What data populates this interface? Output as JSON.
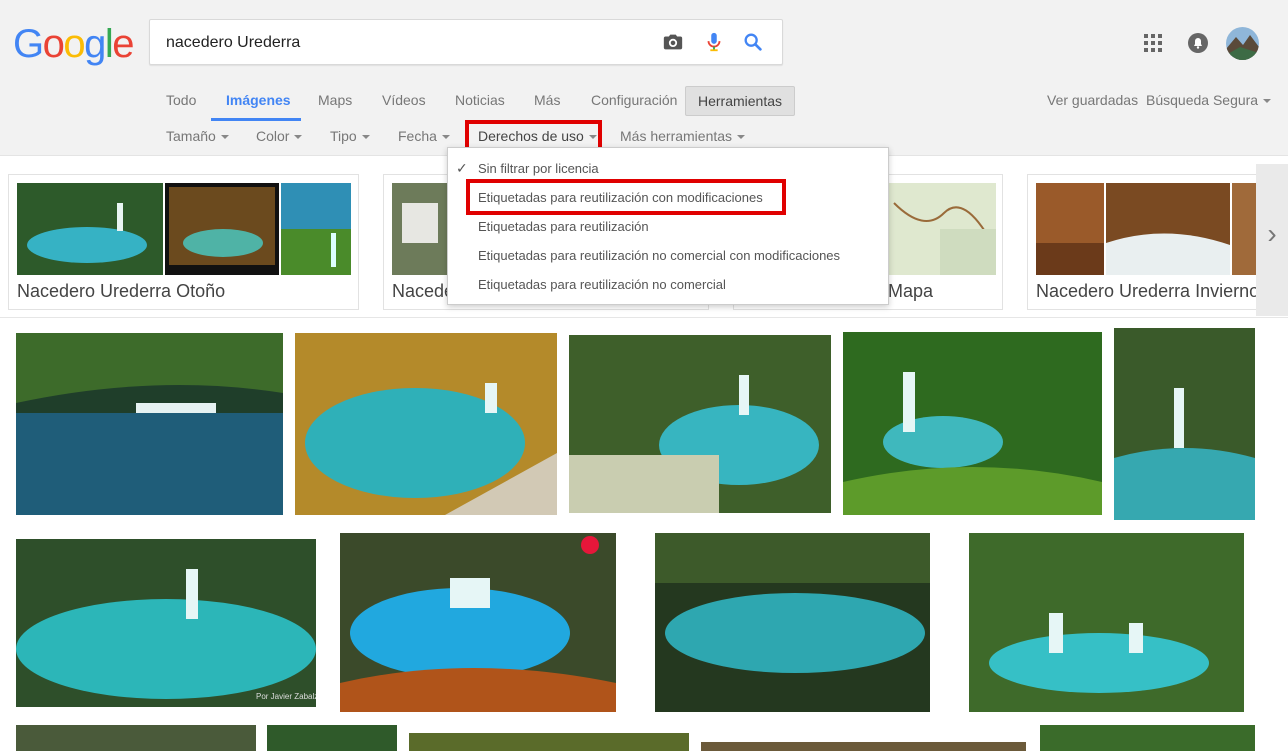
{
  "logo": {
    "letters": [
      "G",
      "o",
      "o",
      "g",
      "l",
      "e"
    ],
    "colors": [
      "#4285F4",
      "#EA4335",
      "#FBBC05",
      "#4285F4",
      "#34A853",
      "#EA4335"
    ]
  },
  "search": {
    "query": "nacedero Urederra"
  },
  "icons": {
    "camera": "camera-icon",
    "mic": "microphone-icon",
    "search": "search-icon",
    "apps": "apps-grid-icon",
    "notifications": "notifications-icon",
    "avatar": "account-avatar"
  },
  "tabs": [
    "Todo",
    "Imágenes",
    "Maps",
    "Vídeos",
    "Noticias",
    "Más",
    "Configuración"
  ],
  "tools_button": "Herramientas",
  "right_links": {
    "saved": "Ver guardadas",
    "safe_search": "Búsqueda Segura"
  },
  "tools": [
    "Tamaño",
    "Color",
    "Tipo",
    "Fecha",
    "Derechos de uso",
    "Más herramientas"
  ],
  "rights_menu": [
    "Sin filtrar por licencia",
    "Etiquetadas para reutilización con modificaciones",
    "Etiquetadas para reutilización",
    "Etiquetadas para reutilización no comercial con modificaciones",
    "Etiquetadas para reutilización no comercial"
  ],
  "related": [
    {
      "label": "Nacedero Urederra Otoño"
    },
    {
      "label": "Nacedero"
    },
    {
      "label": "a Mapa"
    },
    {
      "label": "Nacedero Urederra Invierno"
    }
  ],
  "image_watermark": "Por Javier Zabalza",
  "colors": {
    "accent": "#4285f4",
    "highlight": "#e00000",
    "water": "#2aa7b5",
    "foliage": "#2f6b2a"
  }
}
